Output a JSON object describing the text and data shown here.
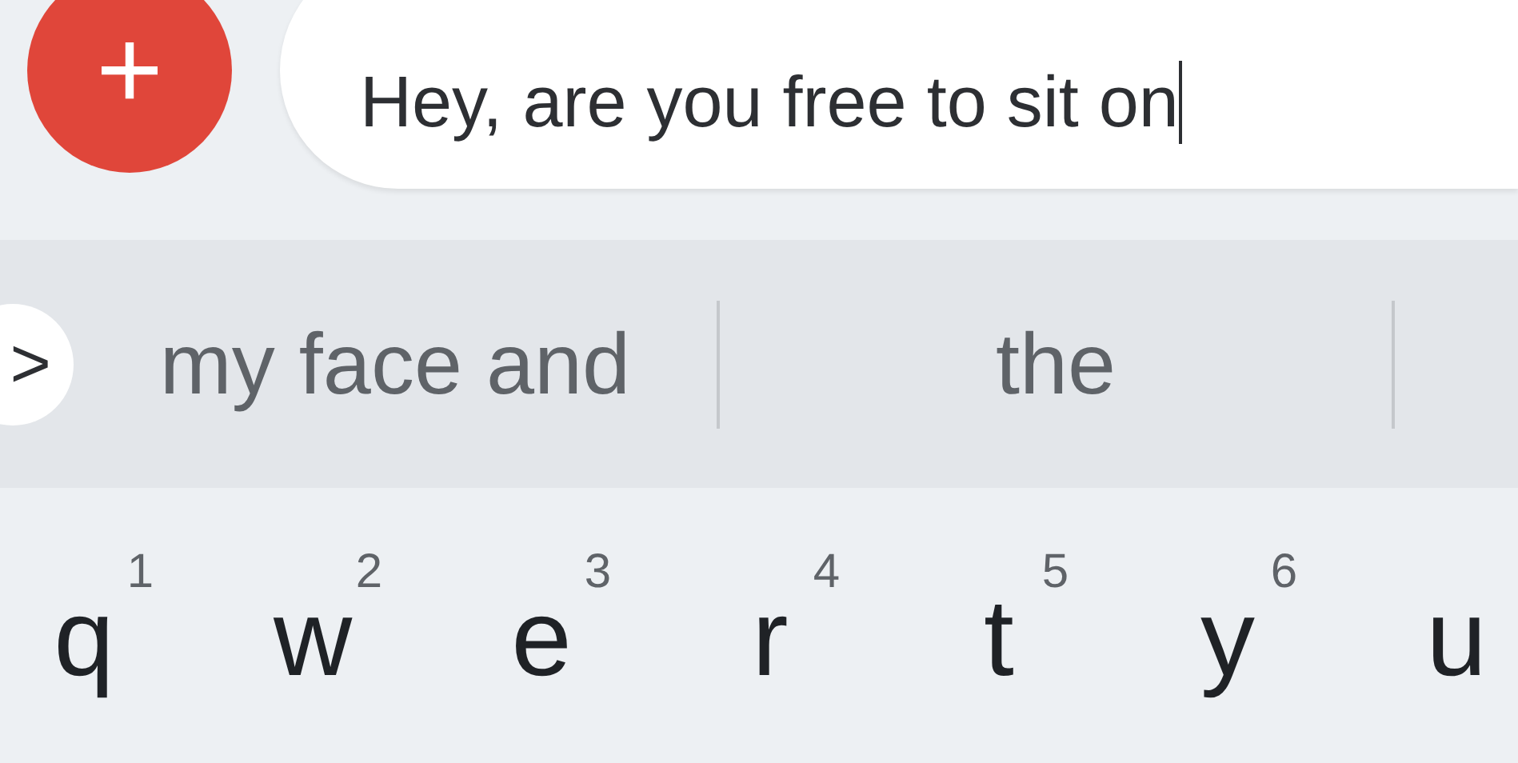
{
  "compose": {
    "add_button": "+",
    "message": "Hey, are you free to sit on"
  },
  "suggestions": {
    "expand": ">",
    "items": [
      "my face and",
      "the"
    ]
  },
  "keyboard": {
    "keys": [
      {
        "letter": "q",
        "hint": "1"
      },
      {
        "letter": "w",
        "hint": "2"
      },
      {
        "letter": "e",
        "hint": "3"
      },
      {
        "letter": "r",
        "hint": "4"
      },
      {
        "letter": "t",
        "hint": "5"
      },
      {
        "letter": "y",
        "hint": "6"
      },
      {
        "letter": "u"
      }
    ]
  }
}
